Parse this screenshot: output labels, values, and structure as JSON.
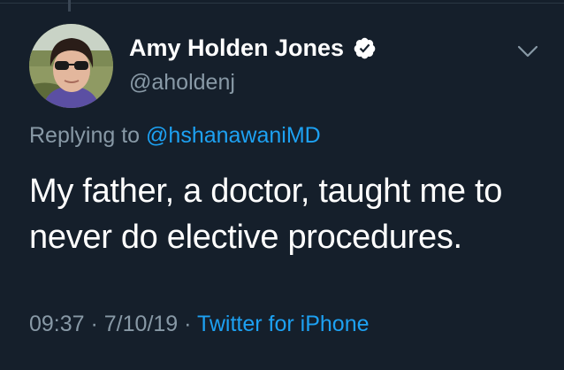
{
  "tweet": {
    "author": {
      "name": "Amy Holden Jones",
      "handle": "@aholdenj",
      "verified": true,
      "avatar": "profile-photo"
    },
    "reply": {
      "prefix": "Replying to ",
      "mention": "@hshanawaniMD"
    },
    "text": "My father, a doctor, taught me to never do elective procedures.",
    "time": "09:37",
    "separator": " · ",
    "date": "7/10/19",
    "source": "Twitter for iPhone",
    "more_icon": "chevron-down-icon"
  },
  "colors": {
    "background": "#151f2b",
    "primary_text": "#ffffff",
    "secondary_text": "#8899a6",
    "link": "#1da1f2"
  }
}
